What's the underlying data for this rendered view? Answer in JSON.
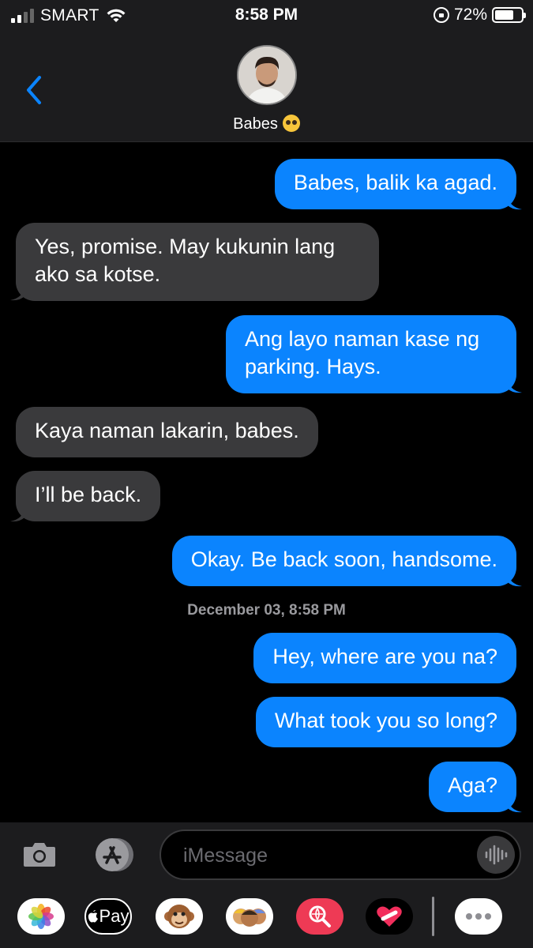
{
  "status_bar": {
    "carrier": "SMART",
    "time": "8:58 PM",
    "battery_percent": "72%",
    "battery_level": 0.72,
    "signal_bars_active": 2,
    "signal_bars_total": 4
  },
  "header": {
    "back_icon": "chevron-left-icon",
    "contact_name": "Babes",
    "contact_emoji": "pleading-face"
  },
  "colors": {
    "sent_bubble": "#0b84fe",
    "received_bubble": "#3a3a3c",
    "background": "#000000",
    "accent": "#0a84ff"
  },
  "messages": [
    {
      "from": "me",
      "text": "Babes, balik ka agad."
    },
    {
      "from": "them",
      "text_lines": [
        "Yes, promise. May kukunin lang",
        "ako sa kotse."
      ]
    },
    {
      "from": "me",
      "text_lines": [
        "Ang layo naman kase ng",
        "parking. Hays."
      ]
    },
    {
      "from": "them",
      "text": "Kaya naman lakarin, babes."
    },
    {
      "from": "them",
      "text": "I’ll be back."
    },
    {
      "from": "me",
      "text": "Okay. Be back soon, handsome."
    },
    {
      "from": "me",
      "text": "Hey, where are you na?"
    },
    {
      "from": "me",
      "text": "What took you so long?"
    },
    {
      "from": "me",
      "text": "Aga?"
    }
  ],
  "timestamp": "December 03, 8:58 PM",
  "input_bar": {
    "placeholder": "iMessage",
    "camera_icon": "camera-icon",
    "appstore_icon": "app-store-icon",
    "audio_icon": "waveform-icon"
  },
  "app_strip": {
    "apps": [
      "photos-icon",
      "apple-pay-icon",
      "memoji-monkey-icon",
      "memoji-stickers-icon",
      "web-images-icon",
      "digital-touch-icon",
      "more-icon"
    ],
    "apple_pay_label": "Pay"
  }
}
